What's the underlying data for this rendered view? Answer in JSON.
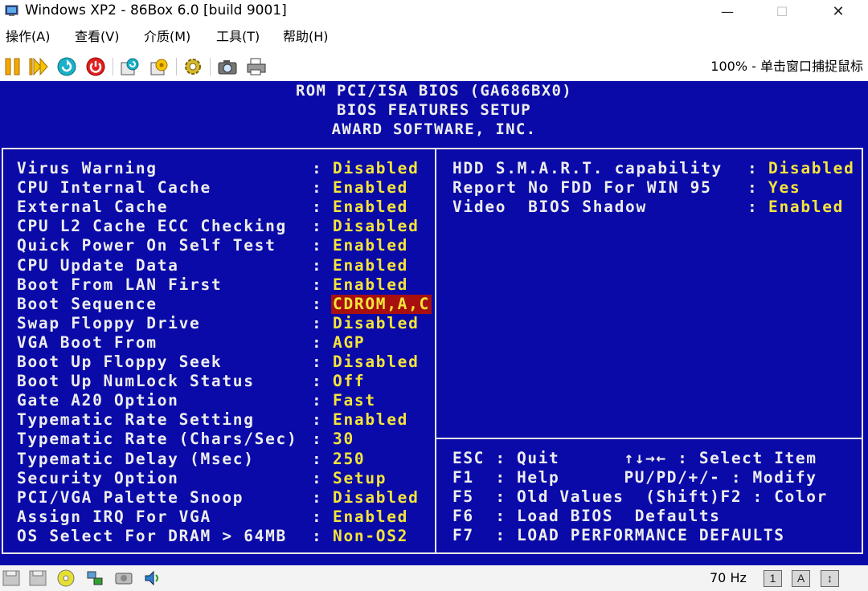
{
  "window": {
    "title": "Windows XP2 - 86Box 6.0 [build 9001]",
    "minimize_glyph": "—",
    "maximize_glyph": "☐",
    "close_glyph": "✕"
  },
  "menu": {
    "items": [
      "操作(A)",
      "查看(V)",
      "介质(M)",
      "工具(T)",
      "帮助(H)"
    ]
  },
  "toolbar": {
    "status": "100% - 单击窗口捕捉鼠标",
    "icons": [
      "pause-icon",
      "fast-forward-icon",
      "reset-icon",
      "power-icon",
      "hard-reset-icon",
      "ctrl-alt-del-icon",
      "settings-icon",
      "screenshot-icon",
      "printer-icon"
    ]
  },
  "bios": {
    "header": [
      "ROM PCI/ISA BIOS (GA686BX0)",
      "BIOS FEATURES SETUP",
      "AWARD SOFTWARE, INC."
    ],
    "left_settings": [
      {
        "label": "Virus Warning",
        "value": "Disabled"
      },
      {
        "label": "CPU Internal Cache",
        "value": "Enabled"
      },
      {
        "label": "External Cache",
        "value": "Enabled"
      },
      {
        "label": "CPU L2 Cache ECC Checking",
        "value": "Disabled"
      },
      {
        "label": "Quick Power On Self Test",
        "value": "Enabled"
      },
      {
        "label": "CPU Update Data",
        "value": "Enabled"
      },
      {
        "label": "Boot From LAN First",
        "value": "Enabled"
      },
      {
        "label": "Boot Sequence",
        "value": "CDROM,A,C"
      },
      {
        "label": "Swap Floppy Drive",
        "value": "Disabled"
      },
      {
        "label": "VGA Boot From",
        "value": "AGP"
      },
      {
        "label": "Boot Up Floppy Seek",
        "value": "Disabled"
      },
      {
        "label": "Boot Up NumLock Status",
        "value": "Off"
      },
      {
        "label": "Gate A20 Option",
        "value": "Fast"
      },
      {
        "label": "Typematic Rate Setting",
        "value": "Enabled"
      },
      {
        "label": "Typematic Rate (Chars/Sec)",
        "value": "30"
      },
      {
        "label": "Typematic Delay (Msec)",
        "value": "250"
      },
      {
        "label": "Security Option",
        "value": "Setup"
      },
      {
        "label": "PCI/VGA Palette Snoop",
        "value": "Disabled"
      },
      {
        "label": "Assign IRQ For VGA",
        "value": "Enabled"
      },
      {
        "label": "OS Select For DRAM > 64MB",
        "value": "Non-OS2"
      }
    ],
    "selected_index": 7,
    "right_settings": [
      {
        "label": "HDD S.M.A.R.T. capability",
        "value": "Disabled"
      },
      {
        "label": "Report No FDD For WIN 95",
        "value": "Yes"
      },
      {
        "label": "Video  BIOS Shadow",
        "value": "Enabled"
      }
    ],
    "colon": ":",
    "help": [
      "ESC : Quit      ↑↓→← : Select Item",
      "F1  : Help      PU/PD/+/- : Modify",
      "F5  : Old Values  (Shift)F2 : Color",
      "F6  : Load BIOS  Defaults",
      "F7  : LOAD PERFORMANCE DEFAULTS"
    ],
    "colors": {
      "background": "#0a0aa8",
      "text": "#ededed",
      "value": "#f5e43a",
      "highlight": "#a81010"
    }
  },
  "statusbar": {
    "icons": [
      "floppy-a-icon",
      "floppy-b-icon",
      "cdrom-icon",
      "network-icon",
      "hard-disk-icon",
      "sound-icon"
    ],
    "refresh_rate": "70 Hz",
    "keys": [
      "1",
      "A",
      "↕"
    ]
  }
}
